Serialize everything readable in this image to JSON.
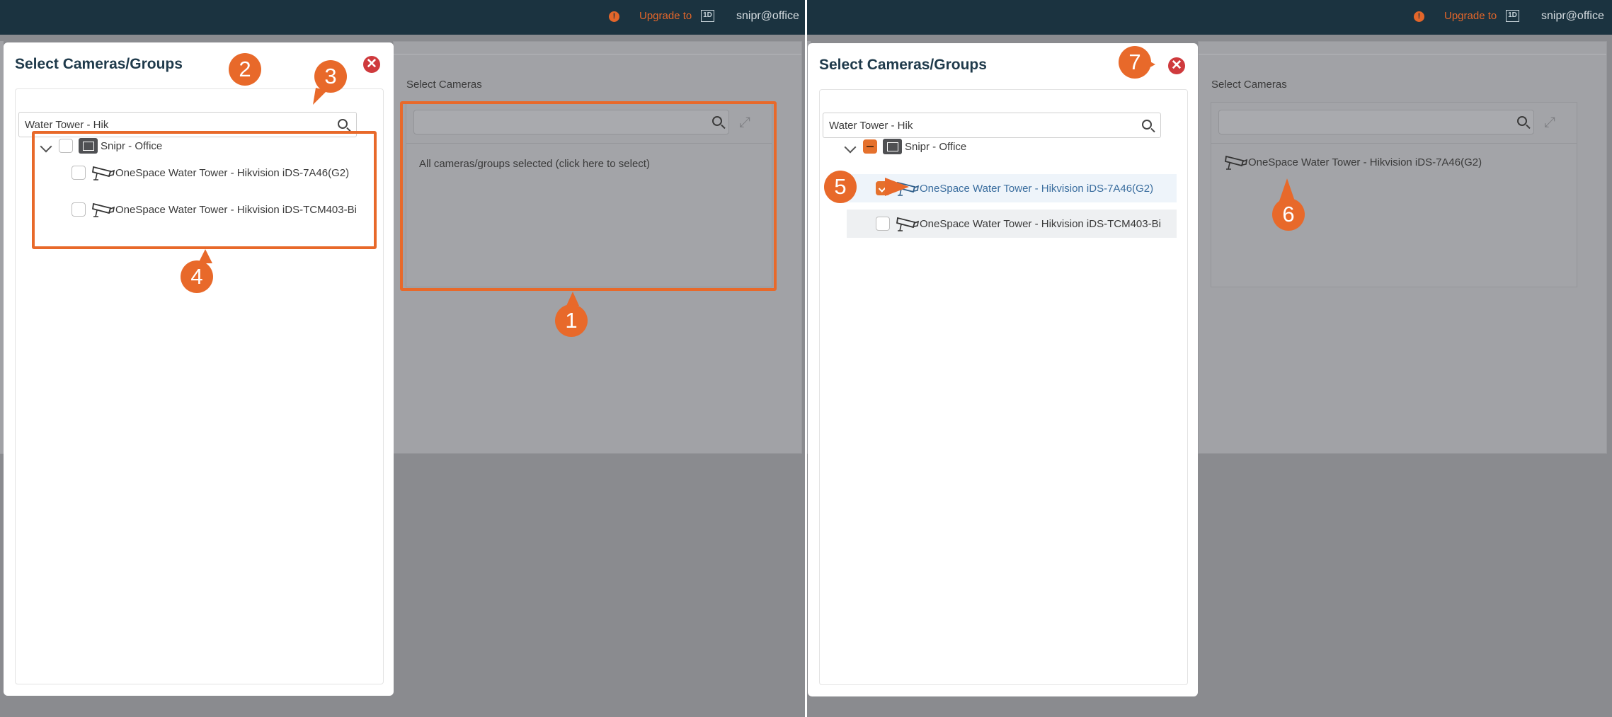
{
  "topbar": {
    "warning_glyph": "!",
    "upgrade_label": "Upgrade to",
    "logo_text": "1D",
    "user": "snipr@office"
  },
  "background": {
    "select_cameras_label": "Select Cameras",
    "all_selected_text": "All cameras/groups selected (click here to select)",
    "selected_camera": "OneSpace Water Tower - Hikvision iDS-7A46(G2)"
  },
  "modal": {
    "title": "Select Cameras/Groups",
    "close_glyph": "✕",
    "search_value": "Water Tower - Hik",
    "group_name": "Snipr - Office",
    "cameras": [
      {
        "name": "OneSpace Water Tower - Hikvision iDS-7A46(G2)"
      },
      {
        "name": "OneSpace Water Tower - Hikvision iDS-TCM403-Bi"
      }
    ]
  },
  "state": {
    "left": {
      "group_checked": false,
      "camera_checked": [
        false,
        false
      ]
    },
    "right": {
      "group_checked": "partial",
      "camera_checked": [
        true,
        false
      ]
    }
  },
  "annotations": [
    "1",
    "2",
    "3",
    "4",
    "5",
    "6",
    "7"
  ],
  "colors": {
    "accent": "#e8692a",
    "topbar": "#1b3340",
    "close": "#cf3a3d",
    "title": "#1f3a4b"
  }
}
